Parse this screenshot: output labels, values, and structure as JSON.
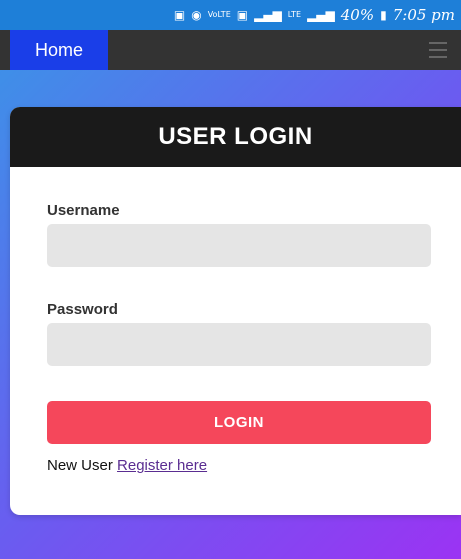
{
  "status_bar": {
    "vol_lte": "VoLTE",
    "lte": "LTE",
    "battery": "40%",
    "time": "7:05 pm"
  },
  "navbar": {
    "home_label": "Home",
    "menu_icon": "hamburger-icon"
  },
  "login": {
    "title": "USER LOGIN",
    "username_label": "Username",
    "username_value": "",
    "password_label": "Password",
    "password_value": "",
    "button_label": "LOGIN",
    "new_user_text": "New User",
    "register_link": "Register here"
  },
  "colors": {
    "status_bar": "#1e7fd8",
    "navbar": "#333333",
    "home_tab": "#1a3ee8",
    "card_header": "#1a1a1a",
    "login_button": "#f5475b",
    "link": "#5a2d91"
  }
}
